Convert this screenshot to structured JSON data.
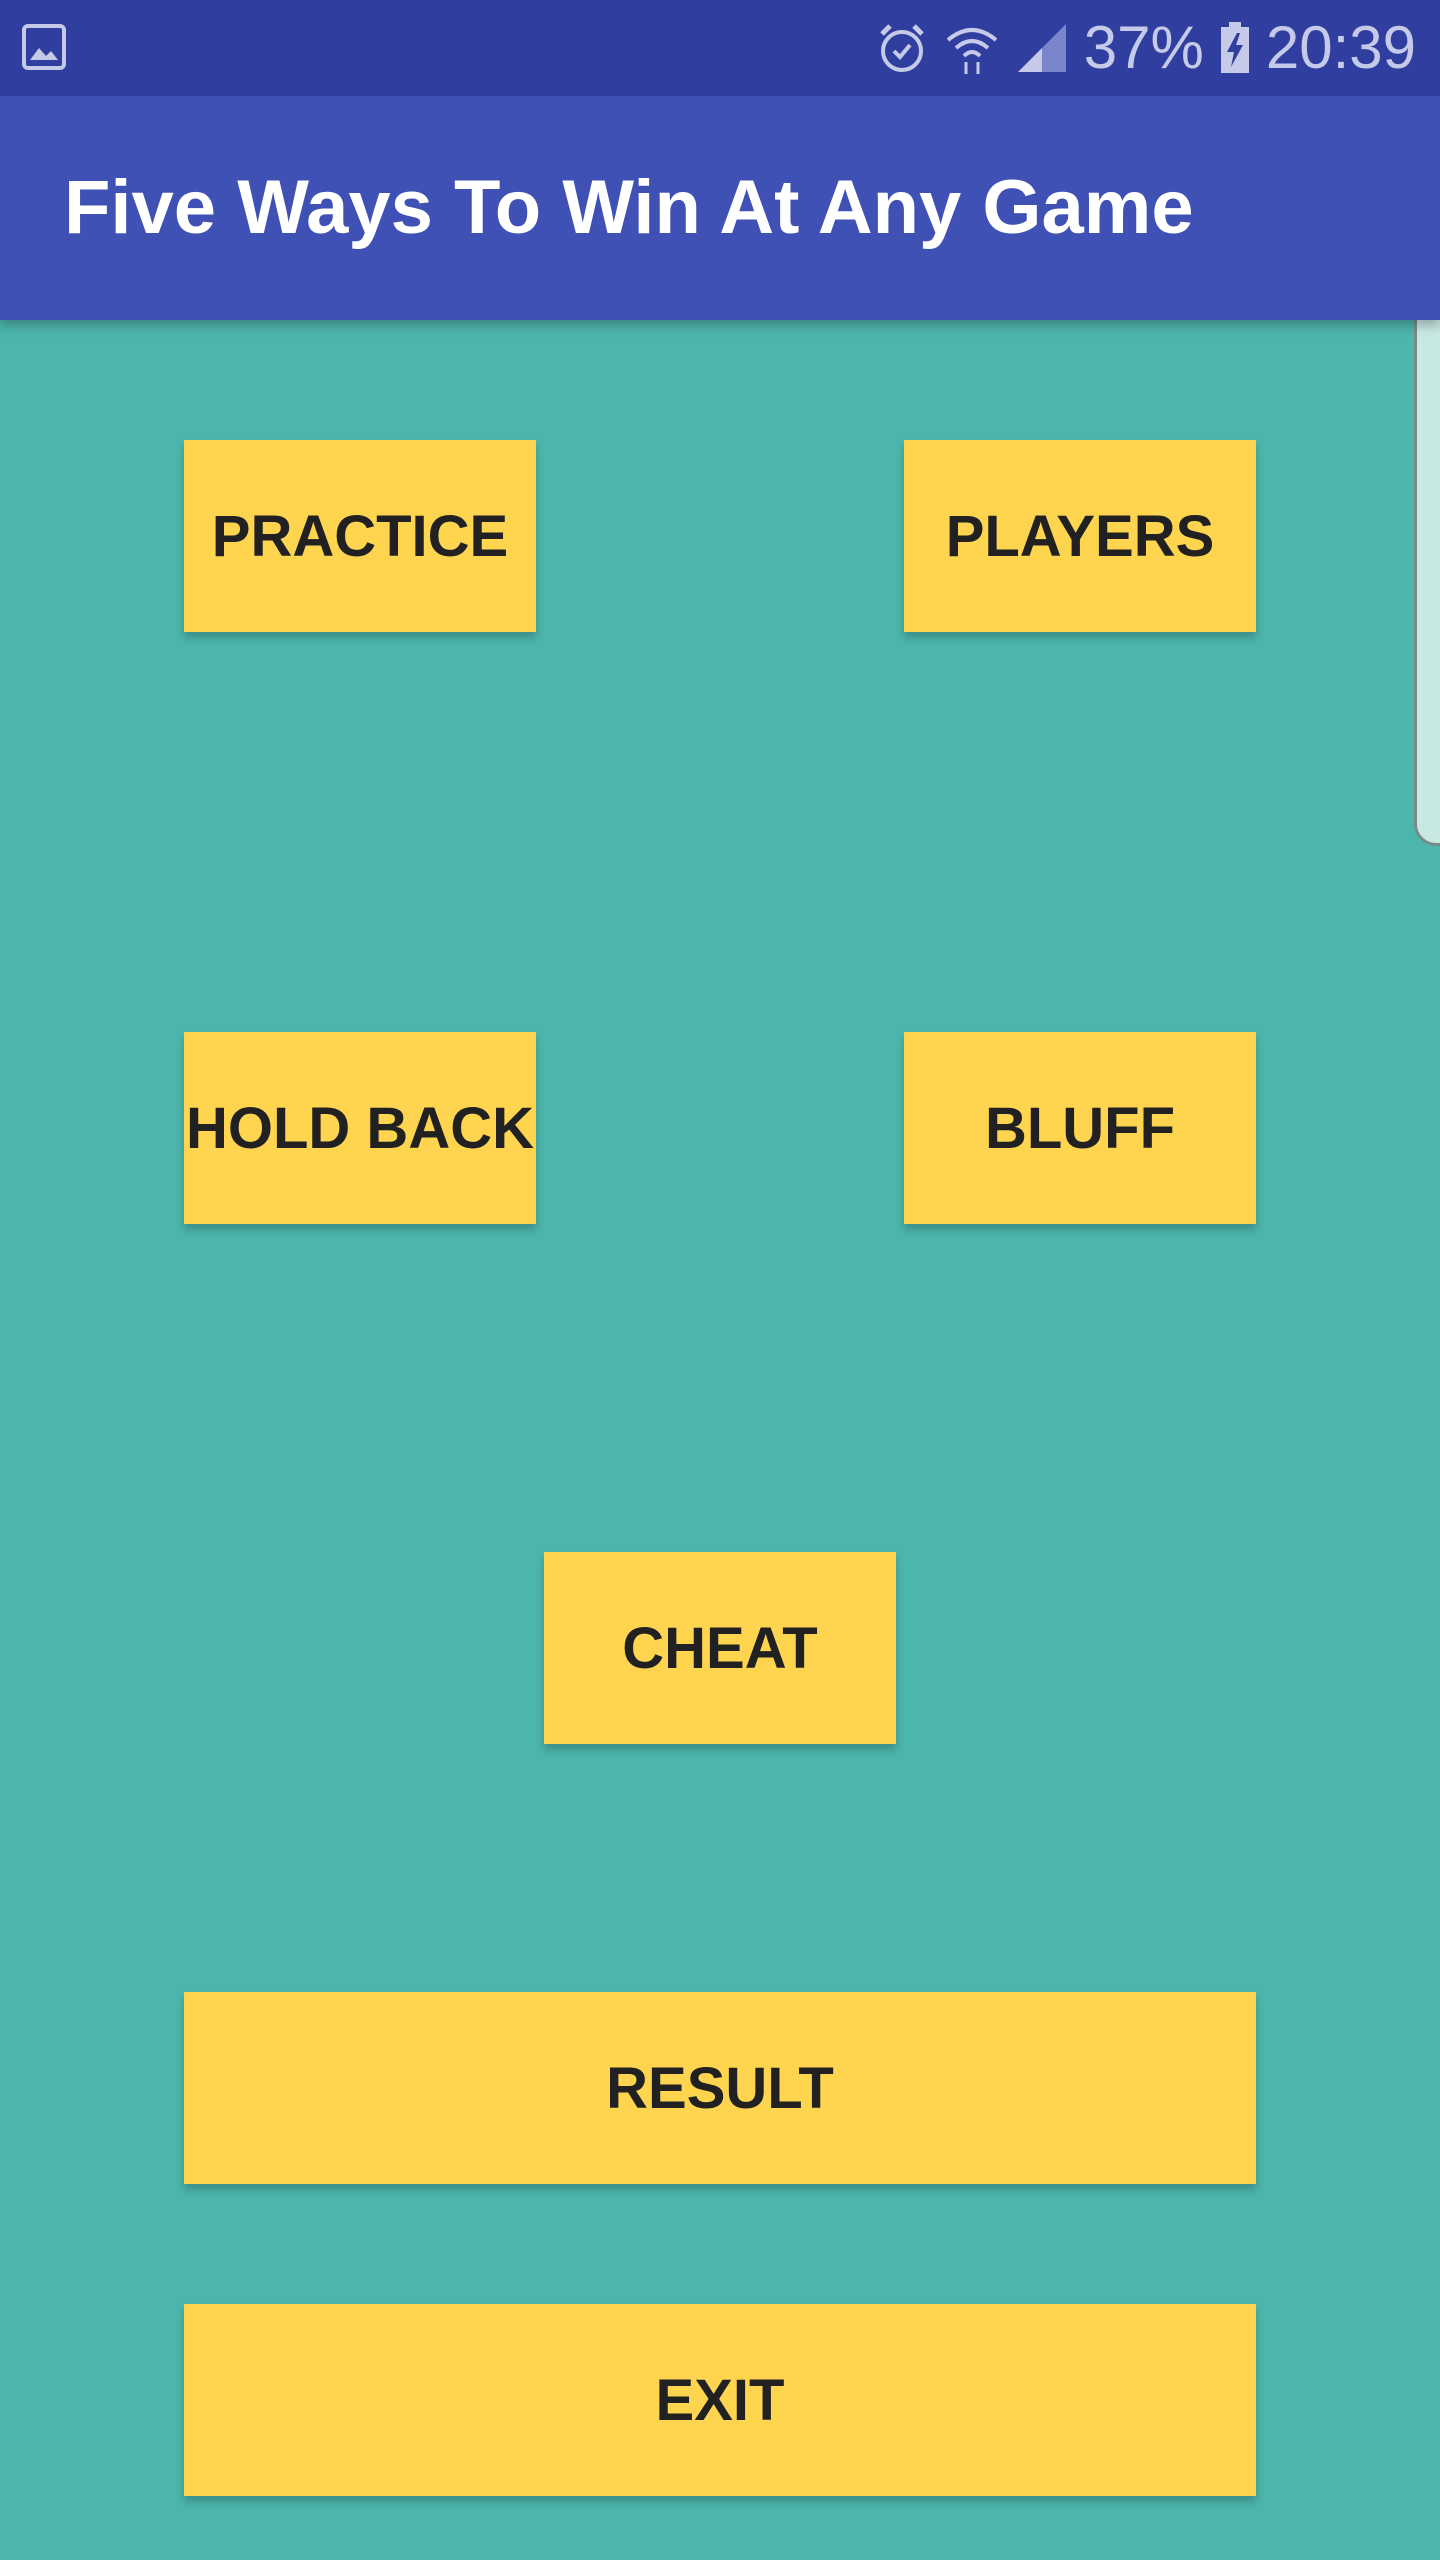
{
  "status_bar": {
    "battery_percent": "37%",
    "time": "20:39",
    "icons": [
      "image-icon",
      "alarm-icon",
      "wifi-icon",
      "signal-icon",
      "battery-charging-icon"
    ]
  },
  "app_bar": {
    "title": "Five Ways To Win At Any Game"
  },
  "buttons": {
    "practice": "PRACTICE",
    "players": "PLAYERS",
    "hold_back": "HOLD BACK",
    "bluff": "BLUFF",
    "cheat": "CHEAT",
    "result": "RESULT",
    "exit": "EXIT"
  },
  "colors": {
    "status_bar": "#303f9f",
    "app_bar": "#3f51b5",
    "background": "#4db6ac",
    "button": "#ffd54f",
    "button_text": "#212121"
  }
}
